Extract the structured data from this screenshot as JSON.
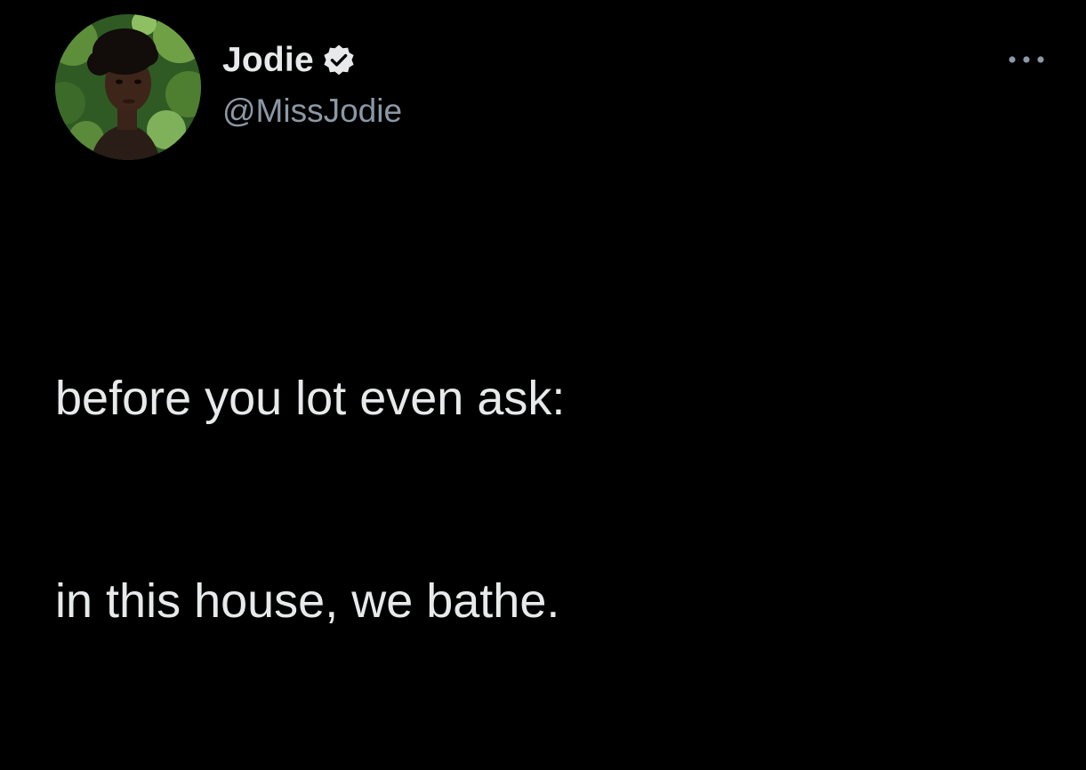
{
  "author": {
    "display_name": "Jodie",
    "handle": "@MissJodie",
    "verified": true,
    "avatar": "profile-photo"
  },
  "tweet": {
    "lines": [
      "before you lot even ask:",
      "in this house, we bathe."
    ]
  },
  "icons": {
    "verified": "verified-badge-icon",
    "more": "more-options-icon"
  },
  "colors": {
    "background": "#000000",
    "primary_text": "#e7e9ea",
    "secondary_text": "#8b98a5"
  }
}
